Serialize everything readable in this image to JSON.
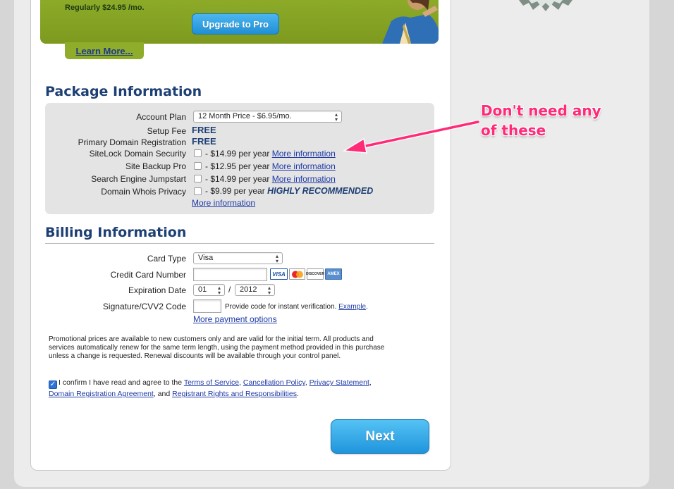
{
  "banner": {
    "regular_price": "Regularly $24.95 /mo.",
    "upgrade_label": "Upgrade to Pro",
    "learn_more": "Learn More..."
  },
  "package": {
    "title": "Package Information",
    "account_plan_label": "Account Plan",
    "account_plan_value": "12 Month Price - $6.95/mo.",
    "setup_fee_label": "Setup Fee",
    "setup_fee_value": "FREE",
    "primary_domain_label": "Primary Domain Registration",
    "primary_domain_value": "FREE",
    "addons": [
      {
        "label": "SiteLock Domain Security",
        "price": "- $14.99 per year",
        "link": "More information"
      },
      {
        "label": "Site Backup Pro",
        "price": "- $12.95 per year",
        "link": "More information"
      },
      {
        "label": "Search Engine Jumpstart",
        "price": "- $14.99 per year",
        "link": "More information"
      },
      {
        "label": "Domain Whois Privacy",
        "price": "- $9.99 per year",
        "note": "HIGHLY RECOMMENDED",
        "link": "More information"
      }
    ]
  },
  "billing": {
    "title": "Billing Information",
    "card_type_label": "Card Type",
    "card_type_value": "Visa",
    "cc_number_label": "Credit Card Number",
    "cc_number_value": "",
    "expiration_label": "Expiration Date",
    "exp_month": "01",
    "exp_sep": "/",
    "exp_year": "2012",
    "cvv_label": "Signature/CVV2 Code",
    "cvv_value": "",
    "cvv_hint": "Provide code for instant verification.",
    "cvv_example": "Example",
    "cvv_period": ".",
    "more_payment": "More payment options",
    "card_logos": [
      "VISA",
      "MC",
      "DISCOVER",
      "AMEX"
    ]
  },
  "promo_text": "Promotional prices are available to new customers only and are valid for the initial term. All products and services automatically renew for the same term length, using the payment method provided in this purchase unless a change is requested. Renewal discounts will be available through your control panel.",
  "confirm": {
    "checked": true,
    "prefix": "I confirm I have read and agree to the",
    "tos": "Terms of Service",
    "cancel": "Cancellation Policy",
    "privacy": "Privacy Statement",
    "domain_agreement": "Domain Registration Agreement",
    "and": "and",
    "registrant": "Registrant Rights and Responsibilities"
  },
  "next_label": "Next",
  "annotation": {
    "line1": "Don't need any",
    "line2": "of these",
    "color": "#ff2a78"
  }
}
